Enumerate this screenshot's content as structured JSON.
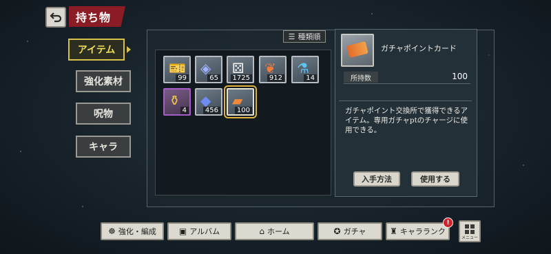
{
  "header": {
    "title": "持ち物"
  },
  "tabs": [
    {
      "label": "アイテム",
      "active": true
    },
    {
      "label": "強化素材",
      "active": false
    },
    {
      "label": "呪物",
      "active": false
    },
    {
      "label": "キャラ",
      "active": false
    }
  ],
  "sort": {
    "label": "種類順",
    "icon": "sort-icon"
  },
  "items": [
    {
      "count": "99",
      "icon": "ticket-icon",
      "rarity": "normal"
    },
    {
      "count": "65",
      "icon": "crystal-bag-icon",
      "rarity": "normal"
    },
    {
      "count": "1725",
      "icon": "dice-icon",
      "rarity": "normal"
    },
    {
      "count": "912",
      "icon": "leaf-icon",
      "rarity": "normal"
    },
    {
      "count": "14",
      "icon": "potion-icon",
      "rarity": "normal"
    },
    {
      "count": "4",
      "icon": "gold-pouch-icon",
      "rarity": "purple"
    },
    {
      "count": "456",
      "icon": "blue-shard-icon",
      "rarity": "normal"
    },
    {
      "count": "100",
      "icon": "gacha-card-icon",
      "rarity": "normal",
      "selected": true
    }
  ],
  "detail": {
    "name": "ガチャポイントカード",
    "quantity_label": "所持数",
    "quantity": "100",
    "description": "ガチャポイント交換所で獲得できるアイテム。専用ガチャptのチャージに使用できる。",
    "obtain_label": "入手方法",
    "use_label": "使用する"
  },
  "nav": [
    {
      "label": "強化・編成",
      "icon": "team-icon"
    },
    {
      "label": "アルバム",
      "icon": "album-icon"
    },
    {
      "label": "ホーム",
      "icon": "home-icon"
    },
    {
      "label": "ガチャ",
      "icon": "gacha-icon"
    },
    {
      "label": "キャラランク",
      "icon": "rank-icon"
    }
  ],
  "menu": {
    "label": "メニュー",
    "alert": "!"
  },
  "colors": {
    "accent": "#d6c24b",
    "banner": "#8b1b24",
    "selected": "#e1b43a",
    "alert": "#d0222a"
  }
}
